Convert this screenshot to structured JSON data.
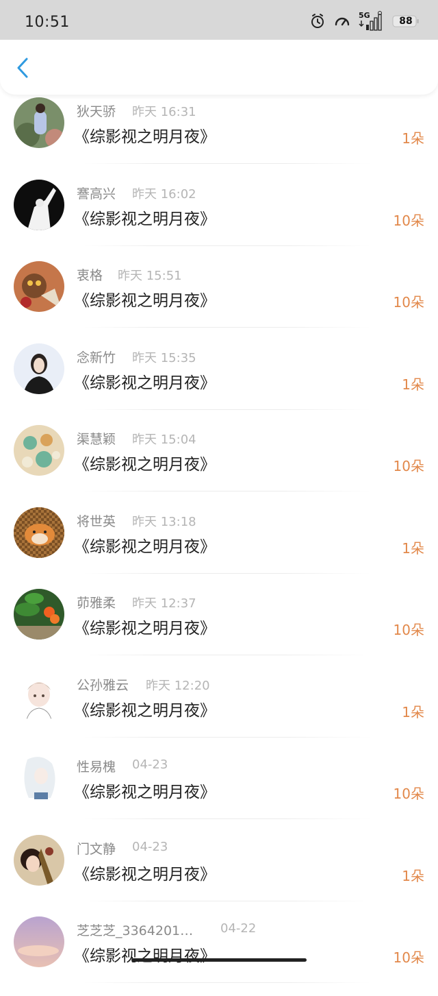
{
  "status_bar": {
    "time": "10:51",
    "network_label": "5G",
    "battery_level": "88",
    "icons": [
      "alarm-icon",
      "speedometer-icon",
      "signal-5g-icon",
      "battery-icon"
    ]
  },
  "header": {
    "back_icon": "chevron-left-icon",
    "accent_color": "#2f9ae0"
  },
  "colors": {
    "amount": "#e2884a",
    "name": "#8a8a8a",
    "time": "#b5b5b5",
    "title": "#222222"
  },
  "rows": [
    {
      "name": "狄天骄",
      "time": "昨天 16:31",
      "title": "《综影视之明月夜》",
      "amount": "1朵"
    },
    {
      "name": "謇高兴",
      "time": "昨天 16:02",
      "title": "《综影视之明月夜》",
      "amount": "10朵"
    },
    {
      "name": "衷格",
      "time": "昨天 15:51",
      "title": "《综影视之明月夜》",
      "amount": "10朵"
    },
    {
      "name": "念新竹",
      "time": "昨天 15:35",
      "title": "《综影视之明月夜》",
      "amount": "1朵"
    },
    {
      "name": "渠慧颖",
      "time": "昨天 15:04",
      "title": "《综影视之明月夜》",
      "amount": "10朵"
    },
    {
      "name": "将世英",
      "time": "昨天 13:18",
      "title": "《综影视之明月夜》",
      "amount": "1朵"
    },
    {
      "name": "茆雅柔",
      "time": "昨天 12:37",
      "title": "《综影视之明月夜》",
      "amount": "10朵"
    },
    {
      "name": "公孙雅云",
      "time": "昨天 12:20",
      "title": "《综影视之明月夜》",
      "amount": "1朵"
    },
    {
      "name": "性易槐",
      "time": "04-23",
      "title": "《综影视之明月夜》",
      "amount": "10朵"
    },
    {
      "name": "门文静",
      "time": "04-23",
      "title": "《综影视之明月夜》",
      "amount": "1朵"
    },
    {
      "name": "芝芝芝_3364201…",
      "time": "04-22",
      "title": "《综影视之明月夜》",
      "amount": "10朵"
    }
  ]
}
